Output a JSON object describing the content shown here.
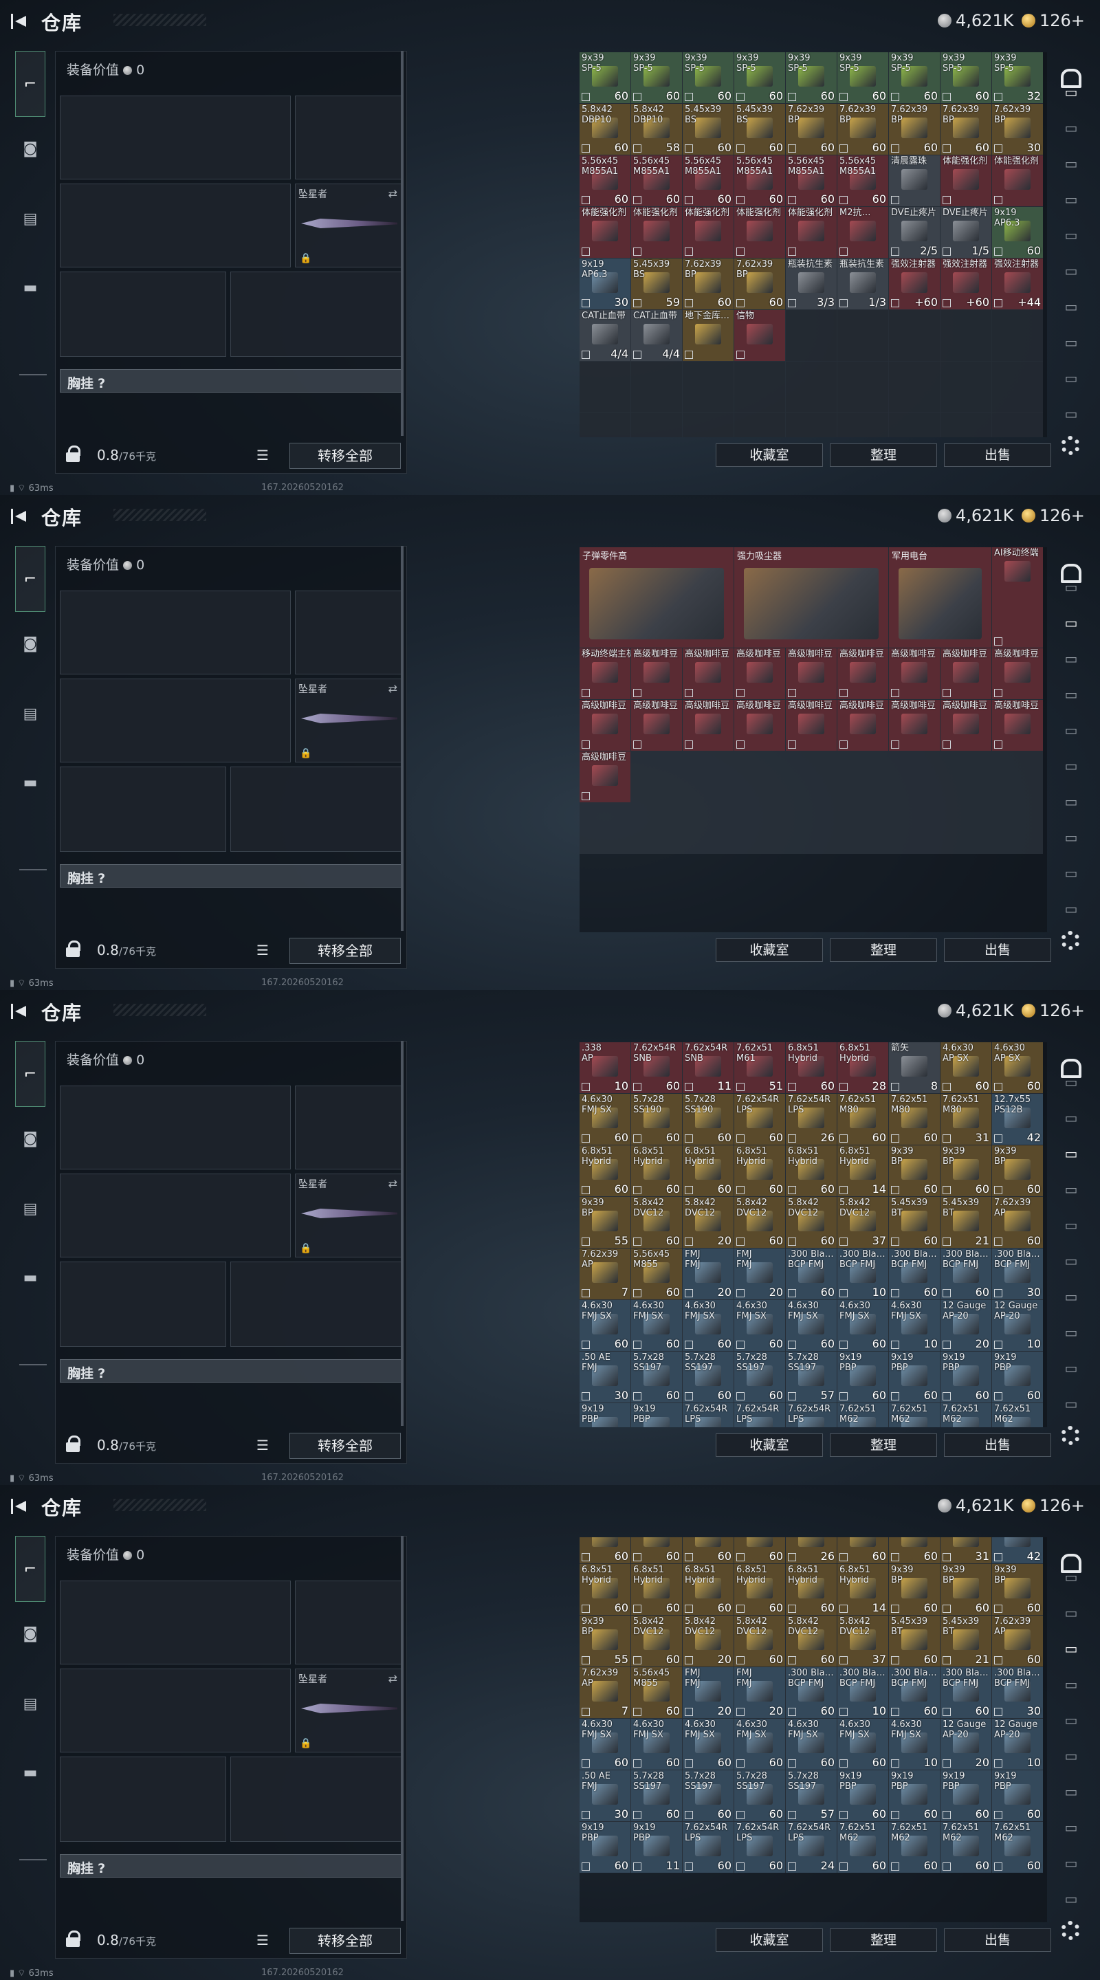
{
  "header": {
    "title": "仓库",
    "silver": "4,621K",
    "gold": "126+"
  },
  "equip": {
    "value_label": "装备价值",
    "value": "0",
    "knife_label": "坠星者",
    "chest_label": "胸挂",
    "chest_hint": "?",
    "weight": "0.8",
    "weight_max": "/76千克",
    "transfer": "转移全部"
  },
  "buttons": {
    "collection": "收藏室",
    "sort": "整理",
    "sell": "出售"
  },
  "status": {
    "ping": "63ms",
    "build": "167.20260520162"
  },
  "icons": {
    "back": "back-arrow-icon",
    "silver": "silver-coin-icon",
    "gold": "gold-coin-icon",
    "settings": "gear-icon",
    "home": "safe-house-icon",
    "list": "list-icon",
    "lock": "padlock-icon"
  },
  "colors": {
    "accent": "#4e8a72",
    "panel": "#0f141b"
  },
  "screens": [
    {
      "cells": [
        {
          "n": "9x39\nSP-5",
          "c": "60",
          "r": "green"
        },
        {
          "n": "9x39\nSP-5",
          "c": "60",
          "r": "green"
        },
        {
          "n": "9x39\nSP-5",
          "c": "60",
          "r": "green"
        },
        {
          "n": "9x39\nSP-5",
          "c": "60",
          "r": "green"
        },
        {
          "n": "9x39\nSP-5",
          "c": "60",
          "r": "green"
        },
        {
          "n": "9x39\nSP-5",
          "c": "60",
          "r": "green"
        },
        {
          "n": "9x39\nSP-5",
          "c": "60",
          "r": "green"
        },
        {
          "n": "9x39\nSP-5",
          "c": "60",
          "r": "green"
        },
        {
          "n": "9x39\nSP-5",
          "c": "32",
          "r": "green"
        },
        {
          "n": "5.8x42\nDBP10",
          "c": "60",
          "r": "gold"
        },
        {
          "n": "5.8x42\nDBP10",
          "c": "58",
          "r": "gold"
        },
        {
          "n": "5.45x39\nBS",
          "c": "60",
          "r": "gold"
        },
        {
          "n": "5.45x39\nBS",
          "c": "60",
          "r": "gold"
        },
        {
          "n": "7.62x39\nBP",
          "c": "60",
          "r": "gold"
        },
        {
          "n": "7.62x39\nBP",
          "c": "60",
          "r": "gold"
        },
        {
          "n": "7.62x39\nBP",
          "c": "60",
          "r": "gold"
        },
        {
          "n": "7.62x39\nBP",
          "c": "60",
          "r": "gold"
        },
        {
          "n": "7.62x39\nBP",
          "c": "30",
          "r": "gold"
        },
        {
          "n": "5.56x45\nM855A1",
          "c": "60",
          "r": "red"
        },
        {
          "n": "5.56x45\nM855A1",
          "c": "60",
          "r": "red"
        },
        {
          "n": "5.56x45\nM855A1",
          "c": "60",
          "r": "red"
        },
        {
          "n": "5.56x45\nM855A1",
          "c": "60",
          "r": "red"
        },
        {
          "n": "5.56x45\nM855A1",
          "c": "60",
          "r": "red"
        },
        {
          "n": "5.56x45\nM855A1",
          "c": "60",
          "r": "red"
        },
        {
          "n": "清晨露珠",
          "c": "",
          "r": "gray"
        },
        {
          "n": "体能强化剂",
          "c": "",
          "r": "red"
        },
        {
          "n": "体能强化剂",
          "c": "",
          "r": "red"
        },
        {
          "n": "体能强化剂",
          "c": "",
          "r": "red"
        },
        {
          "n": "体能强化剂",
          "c": "",
          "r": "red"
        },
        {
          "n": "体能强化剂",
          "c": "",
          "r": "red"
        },
        {
          "n": "体能强化剂",
          "c": "",
          "r": "red"
        },
        {
          "n": "体能强化剂",
          "c": "",
          "r": "red"
        },
        {
          "n": "M2抗…",
          "c": "",
          "r": "red"
        },
        {
          "n": "DVE止疼片",
          "c": "2/5",
          "r": "gray"
        },
        {
          "n": "DVE止疼片",
          "c": "1/5",
          "r": "gray"
        },
        {
          "n": "9x19\nAP6.3",
          "c": "60",
          "r": "green"
        },
        {
          "n": "9x19\nAP6.3",
          "c": "30",
          "r": "blue"
        },
        {
          "n": "5.45x39\nBS",
          "c": "59",
          "r": "gold"
        },
        {
          "n": "7.62x39\nBP",
          "c": "60",
          "r": "gold"
        },
        {
          "n": "7.62x39\nBP",
          "c": "60",
          "r": "gold"
        },
        {
          "n": "瓶装抗生素",
          "c": "3/3",
          "r": "gray"
        },
        {
          "n": "瓶装抗生素",
          "c": "1/3",
          "r": "gray"
        },
        {
          "n": "强效注射器",
          "c": "+60",
          "r": "red"
        },
        {
          "n": "强效注射器",
          "c": "+60",
          "r": "red"
        },
        {
          "n": "强效注射器",
          "c": "+44",
          "r": "red"
        },
        {
          "n": "CAT止血带",
          "c": "4/4",
          "r": "gray"
        },
        {
          "n": "CAT止血带",
          "c": "4/4",
          "r": "gray"
        },
        {
          "n": "地下金库…",
          "c": "",
          "r": "gold"
        },
        {
          "n": "信物",
          "c": "",
          "r": "red"
        }
      ]
    },
    {
      "big": [
        {
          "n": "子弹零件高",
          "span": 3
        },
        {
          "n": "强力吸尘器",
          "span": 3
        },
        {
          "n": "军用电台",
          "span": 2
        }
      ],
      "cells": [
        {
          "n": "AI移动终端",
          "c": ""
        },
        {
          "n": "移动终端主板",
          "c": ""
        },
        {
          "n": "高级咖啡豆",
          "c": ""
        },
        {
          "n": "高级咖啡豆",
          "c": ""
        },
        {
          "n": "高级咖啡豆",
          "c": ""
        },
        {
          "n": "高级咖啡豆",
          "c": ""
        },
        {
          "n": "高级咖啡豆",
          "c": ""
        },
        {
          "n": "高级咖啡豆",
          "c": ""
        },
        {
          "n": "高级咖啡豆",
          "c": ""
        },
        {
          "n": "高级咖啡豆",
          "c": ""
        },
        {
          "n": "高级咖啡豆",
          "c": ""
        },
        {
          "n": "高级咖啡豆",
          "c": ""
        },
        {
          "n": "高级咖啡豆",
          "c": ""
        },
        {
          "n": "高级咖啡豆",
          "c": ""
        },
        {
          "n": "高级咖啡豆",
          "c": ""
        },
        {
          "n": "高级咖啡豆",
          "c": ""
        },
        {
          "n": "高级咖啡豆",
          "c": ""
        },
        {
          "n": "高级咖啡豆",
          "c": ""
        },
        {
          "n": "高级咖啡豆",
          "c": ""
        },
        {
          "n": "高级咖啡豆",
          "c": ""
        }
      ]
    },
    {
      "cells": [
        {
          "n": ".338\nAP",
          "c": "10",
          "r": "red"
        },
        {
          "n": "7.62x54R\nSNB",
          "c": "60",
          "r": "red"
        },
        {
          "n": "7.62x54R\nSNB",
          "c": "11",
          "r": "red"
        },
        {
          "n": "7.62x51\nM61",
          "c": "51",
          "r": "red"
        },
        {
          "n": "6.8x51\nHybrid",
          "c": "60",
          "r": "red"
        },
        {
          "n": "6.8x51\nHybrid",
          "c": "28",
          "r": "red"
        },
        {
          "n": "箭矢",
          "c": "8",
          "r": "gray"
        },
        {
          "n": "4.6x30\nAP SX",
          "c": "60",
          "r": "gold"
        },
        {
          "n": "4.6x30\nAP SX",
          "c": "60",
          "r": "gold"
        },
        {
          "n": "4.6x30\nFMJ SX",
          "c": "60",
          "r": "gold"
        },
        {
          "n": "5.7x28\nSS190",
          "c": "60",
          "r": "gold"
        },
        {
          "n": "5.7x28\nSS190",
          "c": "60",
          "r": "gold"
        },
        {
          "n": "7.62x54R\nLPS",
          "c": "60",
          "r": "gold"
        },
        {
          "n": "7.62x54R\nLPS",
          "c": "26",
          "r": "gold"
        },
        {
          "n": "7.62x51\nM80",
          "c": "60",
          "r": "gold"
        },
        {
          "n": "7.62x51\nM80",
          "c": "60",
          "r": "gold"
        },
        {
          "n": "7.62x51\nM80",
          "c": "31",
          "r": "gold"
        },
        {
          "n": "12.7x55\nPS12B",
          "c": "42",
          "r": "blue"
        },
        {
          "n": "6.8x51\nHybrid",
          "c": "60",
          "r": "gold"
        },
        {
          "n": "6.8x51\nHybrid",
          "c": "60",
          "r": "gold"
        },
        {
          "n": "6.8x51\nHybrid",
          "c": "60",
          "r": "gold"
        },
        {
          "n": "6.8x51\nHybrid",
          "c": "60",
          "r": "gold"
        },
        {
          "n": "6.8x51\nHybrid",
          "c": "60",
          "r": "gold"
        },
        {
          "n": "6.8x51\nHybrid",
          "c": "14",
          "r": "gold"
        },
        {
          "n": "9x39\nBP",
          "c": "60",
          "r": "gold"
        },
        {
          "n": "9x39\nBP",
          "c": "60",
          "r": "gold"
        },
        {
          "n": "9x39\nBP",
          "c": "60",
          "r": "gold"
        },
        {
          "n": "9x39\nBP",
          "c": "55",
          "r": "gold"
        },
        {
          "n": "5.8x42\nDVC12",
          "c": "60",
          "r": "gold"
        },
        {
          "n": "5.8x42\nDVC12",
          "c": "20",
          "r": "gold"
        },
        {
          "n": "5.8x42\nDVC12",
          "c": "60",
          "r": "gold"
        },
        {
          "n": "5.8x42\nDVC12",
          "c": "60",
          "r": "gold"
        },
        {
          "n": "5.8x42\nDVC12",
          "c": "37",
          "r": "gold"
        },
        {
          "n": "5.45x39\nBT",
          "c": "60",
          "r": "gold"
        },
        {
          "n": "5.45x39\nBT",
          "c": "21",
          "r": "gold"
        },
        {
          "n": "7.62x39\nAP",
          "c": "60",
          "r": "gold"
        },
        {
          "n": "7.62x39\nAP",
          "c": "7",
          "r": "gold"
        },
        {
          "n": "5.56x45\nM855",
          "c": "60",
          "r": "gold"
        },
        {
          "n": "FMJ\nFMJ",
          "c": "20",
          "r": "blue"
        },
        {
          "n": "FMJ\nFMJ",
          "c": "20",
          "r": "blue"
        },
        {
          "n": ".300 Bla…\nBCP FMJ",
          "c": "60",
          "r": "blue"
        },
        {
          "n": ".300 Bla…\nBCP FMJ",
          "c": "10",
          "r": "blue"
        },
        {
          "n": ".300 Bla…\nBCP FMJ",
          "c": "60",
          "r": "blue"
        },
        {
          "n": ".300 Bla…\nBCP FMJ",
          "c": "60",
          "r": "blue"
        },
        {
          "n": ".300 Bla…\nBCP FMJ",
          "c": "30",
          "r": "blue"
        },
        {
          "n": "4.6x30\nFMJ SX",
          "c": "60",
          "r": "blue"
        },
        {
          "n": "4.6x30\nFMJ SX",
          "c": "60",
          "r": "blue"
        },
        {
          "n": "4.6x30\nFMJ SX",
          "c": "60",
          "r": "blue"
        },
        {
          "n": "4.6x30\nFMJ SX",
          "c": "60",
          "r": "blue"
        },
        {
          "n": "4.6x30\nFMJ SX",
          "c": "60",
          "r": "blue"
        },
        {
          "n": "4.6x30\nFMJ SX",
          "c": "60",
          "r": "blue"
        },
        {
          "n": "4.6x30\nFMJ SX",
          "c": "10",
          "r": "blue"
        },
        {
          "n": "12 Gauge\nAP-20",
          "c": "20",
          "r": "blue"
        },
        {
          "n": "12 Gauge\nAP-20",
          "c": "10",
          "r": "blue"
        },
        {
          "n": ".50 AE\nFMJ",
          "c": "30",
          "r": "blue"
        },
        {
          "n": "5.7x28\nSS197",
          "c": "60",
          "r": "blue"
        },
        {
          "n": "5.7x28\nSS197",
          "c": "60",
          "r": "blue"
        },
        {
          "n": "5.7x28\nSS197",
          "c": "60",
          "r": "blue"
        },
        {
          "n": "5.7x28\nSS197",
          "c": "57",
          "r": "blue"
        },
        {
          "n": "9x19\nPBP",
          "c": "60",
          "r": "blue"
        },
        {
          "n": "9x19\nPBP",
          "c": "60",
          "r": "blue"
        },
        {
          "n": "9x19\nPBP",
          "c": "60",
          "r": "blue"
        },
        {
          "n": "9x19\nPBP",
          "c": "60",
          "r": "blue"
        },
        {
          "n": "9x19\nPBP",
          "c": "",
          "r": "blue"
        },
        {
          "n": "9x19\nPBP",
          "c": "",
          "r": "blue"
        },
        {
          "n": "7.62x54R\nLPS",
          "c": "",
          "r": "blue"
        },
        {
          "n": "7.62x54R\nLPS",
          "c": "",
          "r": "blue"
        },
        {
          "n": "7.62x54R\nLPS",
          "c": "",
          "r": "blue"
        },
        {
          "n": "7.62x51\nM62",
          "c": "",
          "r": "blue"
        },
        {
          "n": "7.62x51\nM62",
          "c": "",
          "r": "blue"
        },
        {
          "n": "7.62x51\nM62",
          "c": "",
          "r": "blue"
        },
        {
          "n": "7.62x51\nM62",
          "c": "",
          "r": "blue"
        }
      ]
    },
    {
      "cells": [
        {
          "n": "",
          "c": "60",
          "r": "gold"
        },
        {
          "n": "",
          "c": "60",
          "r": "gold"
        },
        {
          "n": "",
          "c": "60",
          "r": "gold"
        },
        {
          "n": "",
          "c": "60",
          "r": "gold"
        },
        {
          "n": "",
          "c": "26",
          "r": "gold"
        },
        {
          "n": "",
          "c": "60",
          "r": "gold"
        },
        {
          "n": "",
          "c": "60",
          "r": "gold"
        },
        {
          "n": "",
          "c": "31",
          "r": "gold"
        },
        {
          "n": "",
          "c": "42",
          "r": "blue"
        },
        {
          "n": "6.8x51\nHybrid",
          "c": "60",
          "r": "gold"
        },
        {
          "n": "6.8x51\nHybrid",
          "c": "60",
          "r": "gold"
        },
        {
          "n": "6.8x51\nHybrid",
          "c": "60",
          "r": "gold"
        },
        {
          "n": "6.8x51\nHybrid",
          "c": "60",
          "r": "gold"
        },
        {
          "n": "6.8x51\nHybrid",
          "c": "60",
          "r": "gold"
        },
        {
          "n": "6.8x51\nHybrid",
          "c": "14",
          "r": "gold"
        },
        {
          "n": "9x39\nBP",
          "c": "60",
          "r": "gold"
        },
        {
          "n": "9x39\nBP",
          "c": "60",
          "r": "gold"
        },
        {
          "n": "9x39\nBP",
          "c": "60",
          "r": "gold"
        },
        {
          "n": "9x39\nBP",
          "c": "55",
          "r": "gold"
        },
        {
          "n": "5.8x42\nDVC12",
          "c": "60",
          "r": "gold"
        },
        {
          "n": "5.8x42\nDVC12",
          "c": "20",
          "r": "gold"
        },
        {
          "n": "5.8x42\nDVC12",
          "c": "60",
          "r": "gold"
        },
        {
          "n": "5.8x42\nDVC12",
          "c": "60",
          "r": "gold"
        },
        {
          "n": "5.8x42\nDVC12",
          "c": "37",
          "r": "gold"
        },
        {
          "n": "5.45x39\nBT",
          "c": "60",
          "r": "gold"
        },
        {
          "n": "5.45x39\nBT",
          "c": "21",
          "r": "gold"
        },
        {
          "n": "7.62x39\nAP",
          "c": "60",
          "r": "gold"
        },
        {
          "n": "7.62x39\nAP",
          "c": "7",
          "r": "gold"
        },
        {
          "n": "5.56x45\nM855",
          "c": "60",
          "r": "gold"
        },
        {
          "n": "FMJ\nFMJ",
          "c": "20",
          "r": "blue"
        },
        {
          "n": "FMJ\nFMJ",
          "c": "20",
          "r": "blue"
        },
        {
          "n": ".300 Bla…\nBCP FMJ",
          "c": "60",
          "r": "blue"
        },
        {
          "n": ".300 Bla…\nBCP FMJ",
          "c": "10",
          "r": "blue"
        },
        {
          "n": ".300 Bla…\nBCP FMJ",
          "c": "60",
          "r": "blue"
        },
        {
          "n": ".300 Bla…\nBCP FMJ",
          "c": "60",
          "r": "blue"
        },
        {
          "n": ".300 Bla…\nBCP FMJ",
          "c": "30",
          "r": "blue"
        },
        {
          "n": "4.6x30\nFMJ SX",
          "c": "60",
          "r": "blue"
        },
        {
          "n": "4.6x30\nFMJ SX",
          "c": "60",
          "r": "blue"
        },
        {
          "n": "4.6x30\nFMJ SX",
          "c": "60",
          "r": "blue"
        },
        {
          "n": "4.6x30\nFMJ SX",
          "c": "60",
          "r": "blue"
        },
        {
          "n": "4.6x30\nFMJ SX",
          "c": "60",
          "r": "blue"
        },
        {
          "n": "4.6x30\nFMJ SX",
          "c": "60",
          "r": "blue"
        },
        {
          "n": "4.6x30\nFMJ SX",
          "c": "10",
          "r": "blue"
        },
        {
          "n": "12 Gauge\nAP-20",
          "c": "20",
          "r": "blue"
        },
        {
          "n": "12 Gauge\nAP-20",
          "c": "10",
          "r": "blue"
        },
        {
          "n": ".50 AE\nFMJ",
          "c": "30",
          "r": "blue"
        },
        {
          "n": "5.7x28\nSS197",
          "c": "60",
          "r": "blue"
        },
        {
          "n": "5.7x28\nSS197",
          "c": "60",
          "r": "blue"
        },
        {
          "n": "5.7x28\nSS197",
          "c": "60",
          "r": "blue"
        },
        {
          "n": "5.7x28\nSS197",
          "c": "57",
          "r": "blue"
        },
        {
          "n": "9x19\nPBP",
          "c": "60",
          "r": "blue"
        },
        {
          "n": "9x19\nPBP",
          "c": "60",
          "r": "blue"
        },
        {
          "n": "9x19\nPBP",
          "c": "60",
          "r": "blue"
        },
        {
          "n": "9x19\nPBP",
          "c": "60",
          "r": "blue"
        },
        {
          "n": "9x19\nPBP",
          "c": "60",
          "r": "blue"
        },
        {
          "n": "9x19\nPBP",
          "c": "11",
          "r": "blue"
        },
        {
          "n": "7.62x54R\nLPS",
          "c": "60",
          "r": "blue"
        },
        {
          "n": "7.62x54R\nLPS",
          "c": "60",
          "r": "blue"
        },
        {
          "n": "7.62x54R\nLPS",
          "c": "24",
          "r": "blue"
        },
        {
          "n": "7.62x51\nM62",
          "c": "60",
          "r": "blue"
        },
        {
          "n": "7.62x51\nM62",
          "c": "60",
          "r": "blue"
        },
        {
          "n": "7.62x51\nM62",
          "c": "60",
          "r": "blue"
        },
        {
          "n": "7.62x51\nM62",
          "c": "60",
          "r": "blue"
        }
      ]
    }
  ]
}
